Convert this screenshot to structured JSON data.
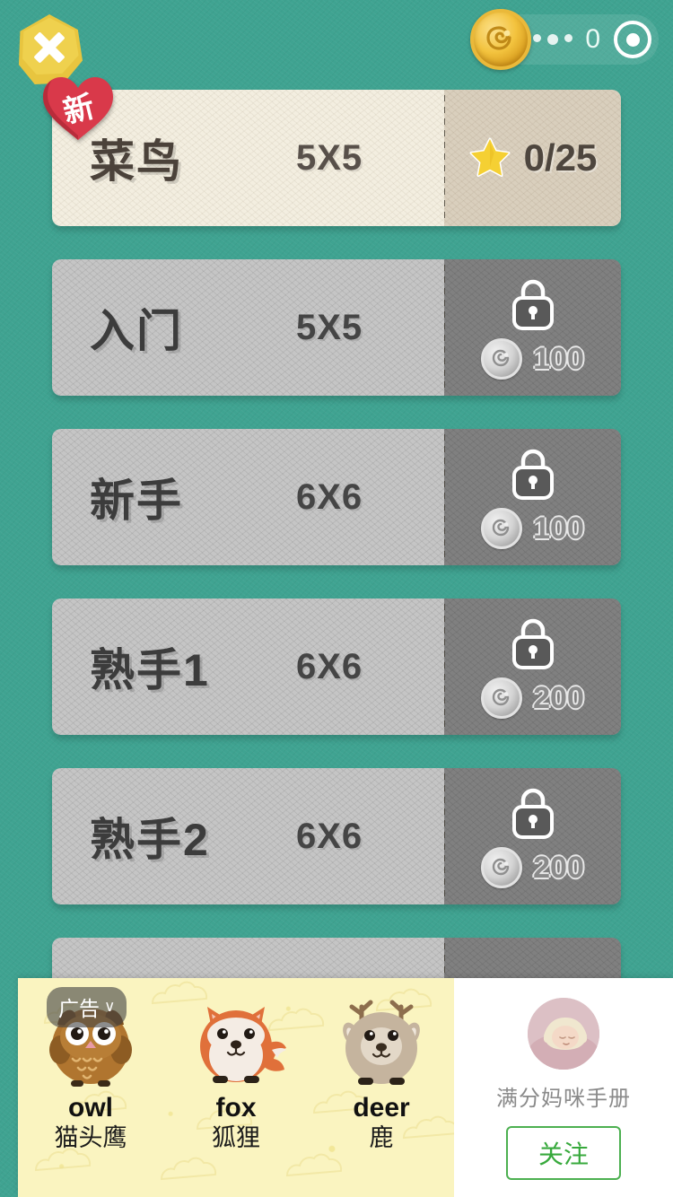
{
  "topbar": {
    "close_label": "×",
    "close_icon": "close-x-icon",
    "currency": {
      "coin_icon": "gold-spiral-coin-icon",
      "value": "0",
      "add_icon": "target-circle-icon"
    }
  },
  "levels": [
    {
      "name": "菜鸟",
      "size": "5X5",
      "state": "unlocked",
      "badge": "新",
      "star_icon": "gold-star-icon",
      "progress": "0/25"
    },
    {
      "name": "入门",
      "size": "5X5",
      "state": "locked",
      "lock_icon": "padlock-icon",
      "coin_icon": "silver-spiral-coin-icon",
      "price": "100"
    },
    {
      "name": "新手",
      "size": "6X6",
      "state": "locked",
      "lock_icon": "padlock-icon",
      "coin_icon": "silver-spiral-coin-icon",
      "price": "100"
    },
    {
      "name": "熟手1",
      "size": "6X6",
      "state": "locked",
      "lock_icon": "padlock-icon",
      "coin_icon": "silver-spiral-coin-icon",
      "price": "200"
    },
    {
      "name": "熟手2",
      "size": "6X6",
      "state": "locked",
      "lock_icon": "padlock-icon",
      "coin_icon": "silver-spiral-coin-icon",
      "price": "200"
    },
    {
      "name": "",
      "size": "",
      "state": "locked",
      "lock_icon": "padlock-icon",
      "coin_icon": "silver-spiral-coin-icon",
      "price": ""
    }
  ],
  "ad": {
    "badge_label": "广告",
    "badge_chevron": "∨",
    "items": [
      {
        "en": "owl",
        "zh": "猫头鹰",
        "icon": "owl-illustration"
      },
      {
        "en": "fox",
        "zh": "狐狸",
        "icon": "fox-illustration"
      },
      {
        "en": "deer",
        "zh": "鹿",
        "icon": "deer-illustration"
      }
    ],
    "advertiser": {
      "avatar_icon": "sleeping-baby-avatar",
      "title": "满分妈咪手册",
      "follow_label": "关注"
    }
  },
  "colors": {
    "background": "#3fa391",
    "card_unlocked": "#f3eee0",
    "card_unlocked_stub": "#d9cfbd",
    "card_locked": "#c5c5c5",
    "card_locked_stub": "#808080",
    "close_button": "#e8c53f",
    "badge_red": "#d9394a",
    "star_gold": "#f5d033",
    "ad_background": "#faf4c0",
    "follow_green": "#37a93c"
  }
}
